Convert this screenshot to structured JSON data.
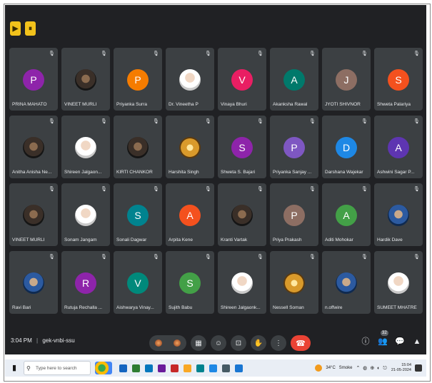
{
  "top_icons": [
    "▶",
    "⏸"
  ],
  "participants": [
    {
      "name": "PRINA MAHATO",
      "initial": "P",
      "color": "#8e24aa",
      "photo": ""
    },
    {
      "name": "VINEET MURLI",
      "initial": "",
      "color": "",
      "photo": "dark"
    },
    {
      "name": "Priyanka Surra",
      "initial": "P",
      "color": "#f57c00",
      "photo": ""
    },
    {
      "name": "Dr. Vineetha P",
      "initial": "",
      "color": "",
      "photo": "light"
    },
    {
      "name": "Vinaya Bhuri",
      "initial": "V",
      "color": "#e91e63",
      "photo": ""
    },
    {
      "name": "Akanksha Rawal",
      "initial": "A",
      "color": "#00796b",
      "photo": ""
    },
    {
      "name": "JYOTI SHIVNOR",
      "initial": "J",
      "color": "#8d6e63",
      "photo": ""
    },
    {
      "name": "Shweta Palariya",
      "initial": "S",
      "color": "#f4511e",
      "photo": ""
    },
    {
      "name": "Anitha Anisha Ne...",
      "initial": "",
      "color": "",
      "photo": "dark"
    },
    {
      "name": "Shireen Jalgaon...",
      "initial": "",
      "color": "",
      "photo": "light"
    },
    {
      "name": "KIRTI CHANKOR",
      "initial": "",
      "color": "",
      "photo": "dark"
    },
    {
      "name": "Harshita Singh",
      "initial": "",
      "color": "",
      "photo": "gold"
    },
    {
      "name": "Shweta S. Bajari",
      "initial": "S",
      "color": "#8e24aa",
      "photo": ""
    },
    {
      "name": "Priyanka Sanjay ...",
      "initial": "P",
      "color": "#7e57c2",
      "photo": ""
    },
    {
      "name": "Darshana Wajekar",
      "initial": "D",
      "color": "#1e88e5",
      "photo": ""
    },
    {
      "name": "Ashwini Sagar P...",
      "initial": "A",
      "color": "#5e35b1",
      "photo": ""
    },
    {
      "name": "VINEET MURLI",
      "initial": "",
      "color": "",
      "photo": "dark"
    },
    {
      "name": "Sonam Jangam",
      "initial": "",
      "color": "",
      "photo": "light"
    },
    {
      "name": "Sonali Dagwar",
      "initial": "S",
      "color": "#00838f",
      "photo": ""
    },
    {
      "name": "Arpita Kene",
      "initial": "A",
      "color": "#f4511e",
      "photo": ""
    },
    {
      "name": "Kranti Vartak",
      "initial": "",
      "color": "",
      "photo": "dark"
    },
    {
      "name": "Priya Prakash",
      "initial": "P",
      "color": "#8d6e63",
      "photo": ""
    },
    {
      "name": "Aditi Mohokar",
      "initial": "A",
      "color": "#43a047",
      "photo": ""
    },
    {
      "name": "Hardik Dave",
      "initial": "",
      "color": "",
      "photo": "blue"
    },
    {
      "name": "Ravi Bari",
      "initial": "",
      "color": "",
      "photo": "blue"
    },
    {
      "name": "Rutuja Rechalla ...",
      "initial": "R",
      "color": "#8e24aa",
      "photo": ""
    },
    {
      "name": "Aishwarya Vinay...",
      "initial": "V",
      "color": "#00897b",
      "photo": ""
    },
    {
      "name": "Sujith Babu",
      "initial": "S",
      "color": "#43a047",
      "photo": ""
    },
    {
      "name": "Shireen Jalgaonk...",
      "initial": "",
      "color": "",
      "photo": "light"
    },
    {
      "name": "Nessell Soman",
      "initial": "",
      "color": "",
      "photo": "gold"
    },
    {
      "name": "n.offwire",
      "initial": "",
      "color": "",
      "photo": "blue"
    },
    {
      "name": "SUMEET MHATRE",
      "initial": "",
      "color": "",
      "photo": "light"
    }
  ],
  "bottom": {
    "time": "3:04 PM",
    "separator": "|",
    "meeting_code": "gek-vnbi-ssu",
    "people_count": "32"
  },
  "controls": [
    "▦",
    "☺",
    "⊡",
    "✋",
    "⋮"
  ],
  "end_call_icon": "☎",
  "right_controls": [
    "ⓘ",
    "👥",
    "💬",
    "▲"
  ],
  "taskbar": {
    "search_placeholder": "Type here to search",
    "temperature": "34°C",
    "weather": "Smoke",
    "time": "15:04",
    "date": "21-05-2024",
    "app_colors": [
      "#1565c0",
      "#2e7d32",
      "#0277bd",
      "#6a1b9a",
      "#c62828",
      "#f9a825",
      "#00838f",
      "#1e88e5",
      "#455a64",
      "#1976d2"
    ]
  }
}
